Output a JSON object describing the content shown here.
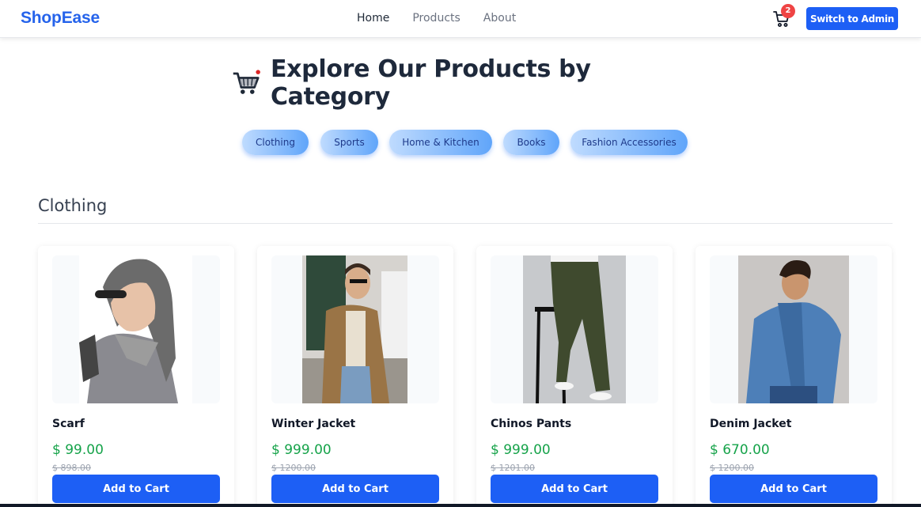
{
  "brand": "ShopEase",
  "nav": {
    "home": "Home",
    "products": "Products",
    "about": "About"
  },
  "cart": {
    "count": "2",
    "icon": "cart-icon"
  },
  "admin_button": "Switch to Admin",
  "heading": {
    "icon": "shopping-cart-emoji",
    "title": "Explore Our Products by Category"
  },
  "categories": [
    "Clothing",
    "Sports",
    "Home & Kitchen",
    "Books",
    "Fashion Accessories"
  ],
  "section_title": "Clothing",
  "products": [
    {
      "name": "Scarf",
      "price": "$ 99.00",
      "old_price": "$ 898.00",
      "button": "Add to Cart"
    },
    {
      "name": "Winter Jacket",
      "price": "$ 999.00",
      "old_price": "$ 1200.00",
      "button": "Add to Cart"
    },
    {
      "name": "Chinos Pants",
      "price": "$ 999.00",
      "old_price": "$ 1201.00",
      "button": "Add to Cart"
    },
    {
      "name": "Denim Jacket",
      "price": "$ 670.00",
      "old_price": "$ 1200.00",
      "button": "Add to Cart"
    }
  ],
  "colors": {
    "brand": "#2563eb",
    "primary_button": "#1d5ff5",
    "price": "#16a34a",
    "badge": "#ef4444"
  }
}
